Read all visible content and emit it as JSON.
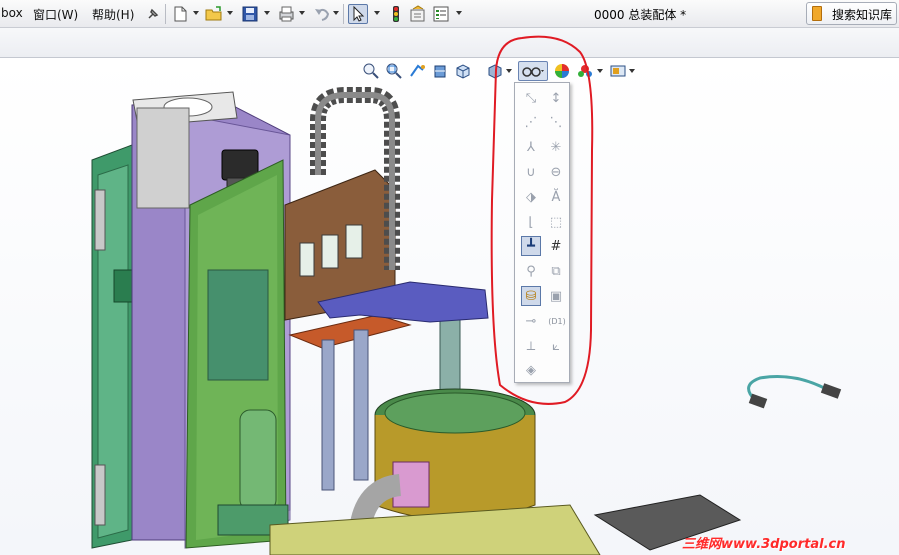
{
  "menu": {
    "items": [
      {
        "label": "box"
      },
      {
        "label": "窗口(W)"
      },
      {
        "label": "帮助(H)"
      }
    ]
  },
  "toolbar": {
    "document_title": "0000 总装配体 *",
    "knowledge_search_label": "搜索知识库"
  },
  "heads_up_toolbar": {
    "icons": [
      "zoom-to-fit",
      "zoom-area",
      "previous-view",
      "section-view",
      "view-orientation",
      "display-style",
      "hide-show-items",
      "edit-appearance",
      "apply-scene",
      "view-settings"
    ]
  },
  "flyout": {
    "items": [
      {
        "icon": "axes-icon"
      },
      {
        "icon": "axes-dim-icon"
      },
      {
        "icon": "temporary-axes-icon"
      },
      {
        "icon": "planes-icon"
      },
      {
        "icon": "origins-icon"
      },
      {
        "icon": "points-icon"
      },
      {
        "icon": "curves-icon"
      },
      {
        "icon": "parting-lines-icon"
      },
      {
        "icon": "sketch-icon"
      },
      {
        "icon": "annotations-icon"
      },
      {
        "icon": "3d-sketch-planes-icon"
      },
      {
        "icon": "grid-icon"
      },
      {
        "icon": "sketch-relations-icon"
      },
      {
        "icon": "lights-icon"
      },
      {
        "icon": "cameras-icon"
      },
      {
        "icon": "decals-icon"
      },
      {
        "icon": "routing-points-icon"
      },
      {
        "icon": "dimension-names-icon"
      },
      {
        "icon": "primary-planes-icon"
      },
      {
        "icon": "ref-geometry-icon"
      },
      {
        "icon": "all-annotations-icon"
      }
    ],
    "dim_label": "(D1)"
  },
  "watermark": "三维网www.3dportal.cn",
  "colors": {
    "annotation_circle": "#e01b24",
    "frame_green": "#3f9a6a",
    "panel_purple": "#9a86c8",
    "base_yellow": "#b89a2a",
    "plate_blue": "#5a5cc0"
  }
}
